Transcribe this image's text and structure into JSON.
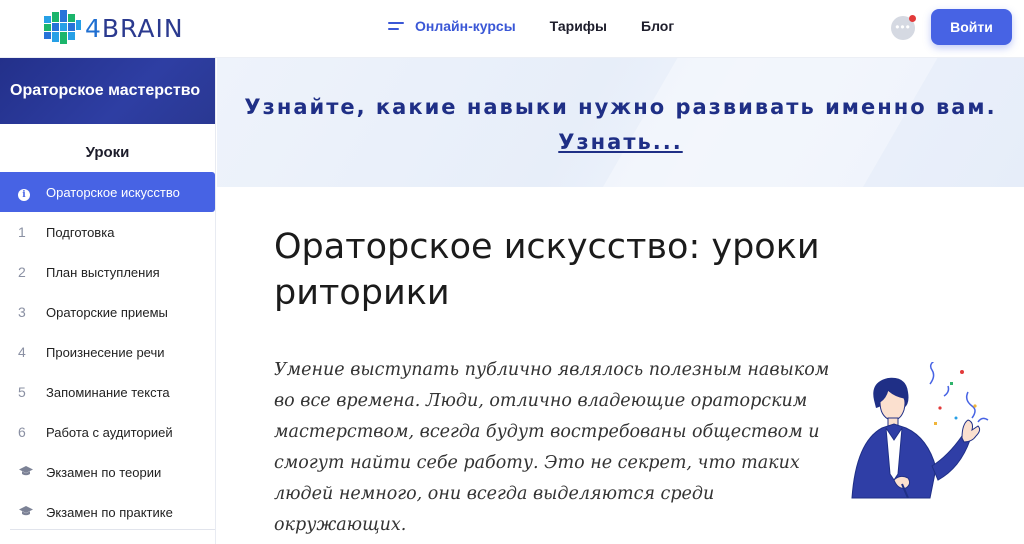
{
  "header": {
    "logo_text_prefix": "4",
    "logo_text": "BRAIN",
    "nav": [
      {
        "label": "Онлайн-курсы",
        "active": true
      },
      {
        "label": "Тарифы",
        "active": false
      },
      {
        "label": "Блог",
        "active": false
      }
    ],
    "login_label": "Войти"
  },
  "sidebar": {
    "course_title": "Ораторское мастерство",
    "lessons_title": "Уроки",
    "items": [
      {
        "marker": "i",
        "label": "Ораторское искусство",
        "active": true
      },
      {
        "marker": "1",
        "label": "Подготовка"
      },
      {
        "marker": "2",
        "label": "План выступления"
      },
      {
        "marker": "3",
        "label": "Ораторские приемы"
      },
      {
        "marker": "4",
        "label": "Произнесение речи"
      },
      {
        "marker": "5",
        "label": "Запоминание текста"
      },
      {
        "marker": "6",
        "label": "Работа с аудиторией"
      },
      {
        "marker": "cap",
        "label": "Экзамен по теории"
      },
      {
        "marker": "cap",
        "label": "Экзамен по практике"
      }
    ]
  },
  "banner": {
    "text": "Узнайте, какие навыки нужно развивать именно вам.",
    "link": "Узнать..."
  },
  "main": {
    "title": "Ораторское искусство: уроки риторики",
    "intro": "Умение выступать публично являлось полезным навыком во все времена. Люди, отлично владеющие ораторским мастерством, всегда будут востребованы обществом и смогут найти себе работу. Это не секрет, что таких людей немного, они всегда выделяются среди окружающих."
  },
  "colors": {
    "accent": "#4763e4",
    "brand_dark": "#23308a",
    "banner_text": "#1f2f86"
  }
}
